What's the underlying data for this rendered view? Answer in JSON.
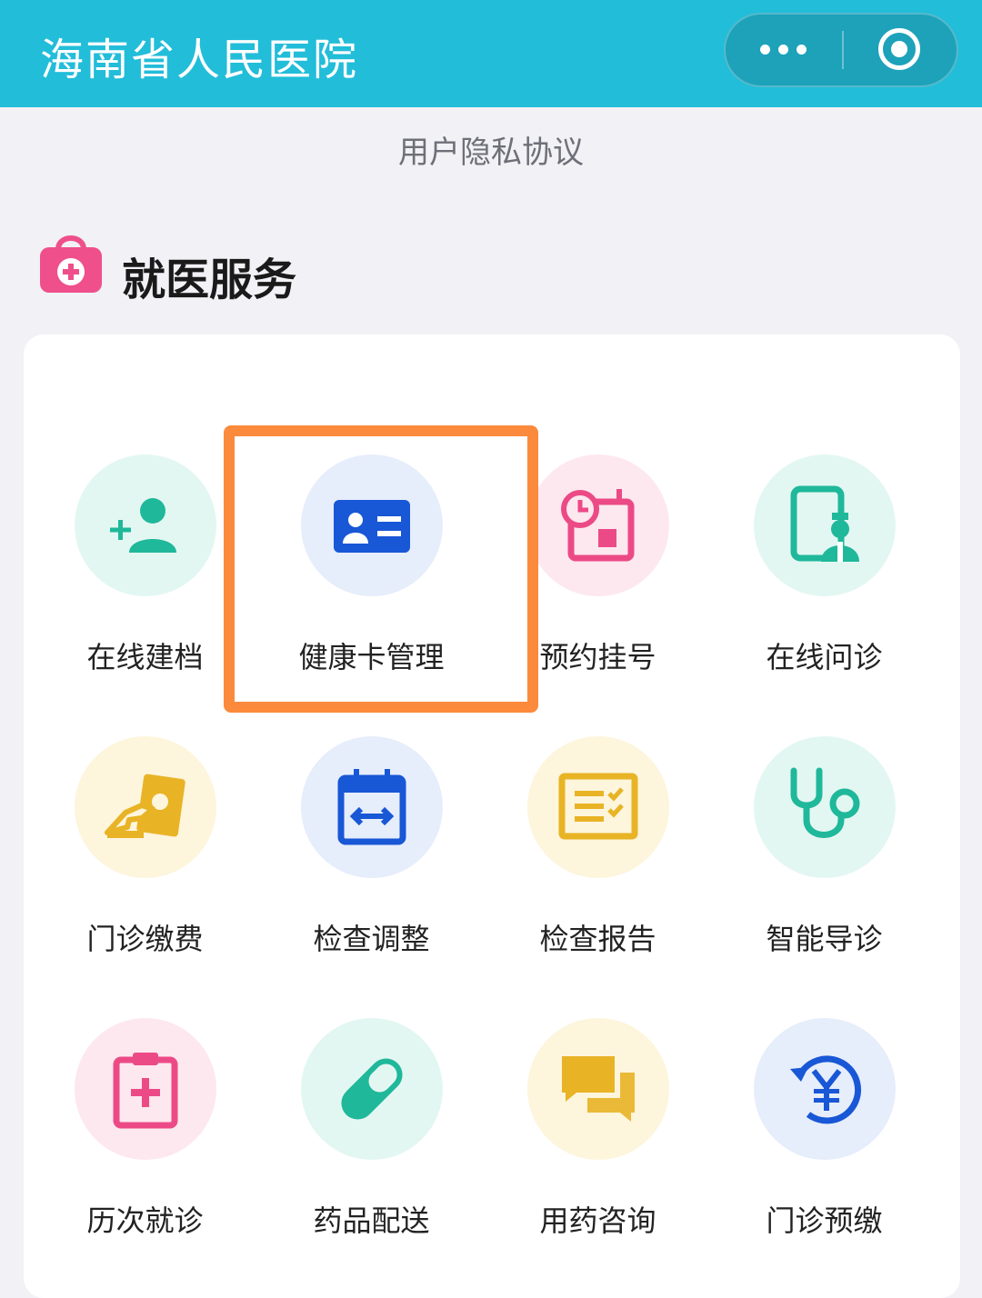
{
  "header": {
    "title": "海南省人民医院",
    "accent_color": "#22bdd9",
    "more_icon": "more-dots-icon",
    "close_icon": "target-close-icon"
  },
  "privacy_link": "用户隐私协议",
  "section": {
    "title": "就医服务",
    "icon": "medical-bag-icon",
    "icon_color": "#ef4f8b"
  },
  "services": [
    {
      "label": "在线建档",
      "icon": "add-user-icon",
      "color": "#1fb89a",
      "bg": "#e3f7f2"
    },
    {
      "label": "健康卡管理",
      "icon": "id-card-icon",
      "color": "#1857d6",
      "bg": "#e6edfb"
    },
    {
      "label": "预约挂号",
      "icon": "clock-calendar-icon",
      "color": "#ec4a86",
      "bg": "#fde8ef"
    },
    {
      "label": "在线问诊",
      "icon": "tablet-doctor-icon",
      "color": "#1fb89a",
      "bg": "#e3f7f2"
    },
    {
      "label": "门诊缴费",
      "icon": "hand-payment-icon",
      "color": "#e8b325",
      "bg": "#fdf5dc"
    },
    {
      "label": "检查调整",
      "icon": "calendar-swap-icon",
      "color": "#1857d6",
      "bg": "#e6edfb"
    },
    {
      "label": "检查报告",
      "icon": "report-checklist-icon",
      "color": "#e8b325",
      "bg": "#fdf5dc"
    },
    {
      "label": "智能导诊",
      "icon": "stethoscope-icon",
      "color": "#1fb89a",
      "bg": "#e3f7f2"
    },
    {
      "label": "历次就诊",
      "icon": "clipboard-medical-icon",
      "color": "#ec4a86",
      "bg": "#fde8ef"
    },
    {
      "label": "药品配送",
      "icon": "pill-capsule-icon",
      "color": "#1fb89a",
      "bg": "#e3f7f2"
    },
    {
      "label": "用药咨询",
      "icon": "chat-bubbles-icon",
      "color": "#e8b325",
      "bg": "#fdf5dc"
    },
    {
      "label": "门诊预缴",
      "icon": "yuan-refresh-icon",
      "color": "#1857d6",
      "bg": "#e6edfb"
    }
  ],
  "highlight_color": "#fb8a3c"
}
